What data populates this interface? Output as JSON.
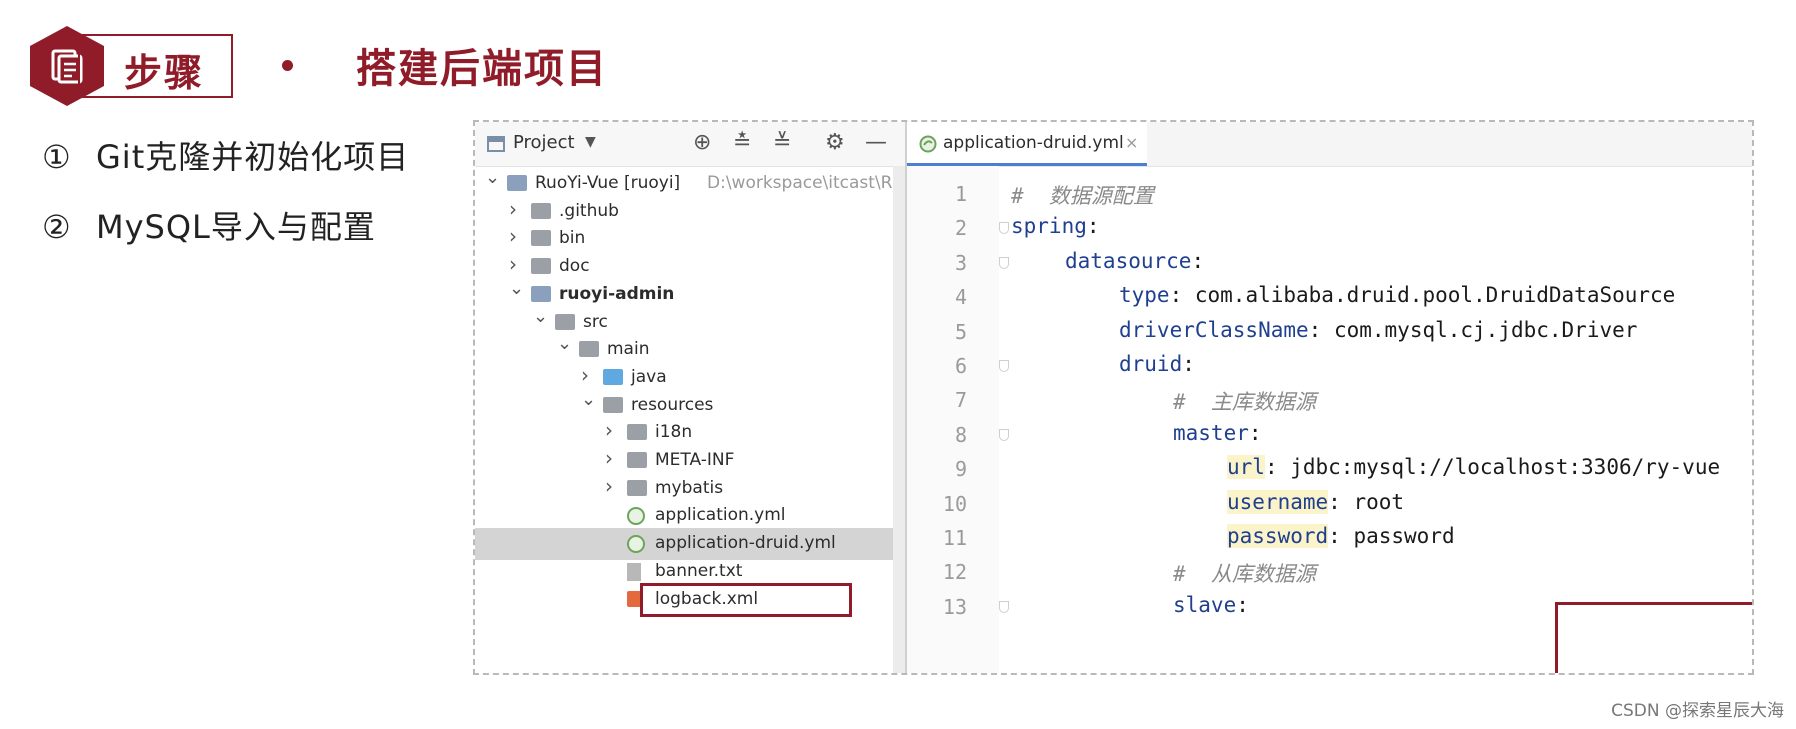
{
  "header": {
    "badge_label": "步骤",
    "title": "搭建后端项目",
    "accent_color": "#8f1c28"
  },
  "steps": [
    {
      "num": "①",
      "label": "Git克隆并初始化项目"
    },
    {
      "num": "②",
      "label": "MySQL导入与配置"
    }
  ],
  "ide": {
    "project_panel": {
      "title": "Project",
      "tools": [
        "target-icon",
        "expand-all-icon",
        "collapse-all-icon",
        "gear-icon",
        "minimize-icon"
      ]
    },
    "tree": [
      {
        "label": "RuoYi-Vue [ruoyi]",
        "path": "D:\\workspace\\itcast\\RuoYi-",
        "depth": 0,
        "expanded": true,
        "type": "module"
      },
      {
        "label": ".github",
        "depth": 1,
        "expanded": false,
        "type": "folder"
      },
      {
        "label": "bin",
        "depth": 1,
        "expanded": false,
        "type": "folder"
      },
      {
        "label": "doc",
        "depth": 1,
        "expanded": false,
        "type": "folder"
      },
      {
        "label": "ruoyi-admin",
        "depth": 1,
        "expanded": true,
        "type": "module"
      },
      {
        "label": "src",
        "depth": 2,
        "expanded": true,
        "type": "folder"
      },
      {
        "label": "main",
        "depth": 3,
        "expanded": true,
        "type": "folder"
      },
      {
        "label": "java",
        "depth": 4,
        "expanded": false,
        "type": "folder-blue"
      },
      {
        "label": "resources",
        "depth": 4,
        "expanded": true,
        "type": "folder-res"
      },
      {
        "label": "i18n",
        "depth": 5,
        "expanded": false,
        "type": "folder"
      },
      {
        "label": "META-INF",
        "depth": 5,
        "expanded": false,
        "type": "folder"
      },
      {
        "label": "mybatis",
        "depth": 5,
        "expanded": false,
        "type": "folder"
      },
      {
        "label": "application.yml",
        "depth": 5,
        "type": "yml"
      },
      {
        "label": "application-druid.yml",
        "depth": 5,
        "type": "yml",
        "selected": true
      },
      {
        "label": "banner.txt",
        "depth": 5,
        "type": "txt"
      },
      {
        "label": "logback.xml",
        "depth": 5,
        "type": "xml"
      }
    ],
    "editor": {
      "tab_label": "application-druid.yml",
      "lines": [
        {
          "n": "1",
          "indent": 0,
          "comment": "#  数据源配置"
        },
        {
          "n": "2",
          "indent": 0,
          "key": "spring",
          "value": ""
        },
        {
          "n": "3",
          "indent": 1,
          "key": "datasource",
          "value": ""
        },
        {
          "n": "4",
          "indent": 2,
          "key": "type",
          "value": " com.alibaba.druid.pool.DruidDataSource"
        },
        {
          "n": "5",
          "indent": 2,
          "key": "driverClassName",
          "value": " com.mysql.cj.jdbc.Driver"
        },
        {
          "n": "6",
          "indent": 2,
          "key": "druid",
          "value": ""
        },
        {
          "n": "7",
          "indent": 3,
          "comment": "#  主库数据源"
        },
        {
          "n": "8",
          "indent": 3,
          "key": "master",
          "value": ""
        },
        {
          "n": "9",
          "indent": 4,
          "key": "url",
          "value": " jdbc:mysql://localhost:3306/ry-vue"
        },
        {
          "n": "10",
          "indent": 4,
          "key": "username",
          "value": " root"
        },
        {
          "n": "11",
          "indent": 4,
          "key": "password",
          "value": " password"
        },
        {
          "n": "12",
          "indent": 3,
          "comment": "#  从库数据源"
        },
        {
          "n": "13",
          "indent": 3,
          "key": "slave",
          "value": ""
        }
      ]
    }
  },
  "watermark": "CSDN @探索星辰大海"
}
